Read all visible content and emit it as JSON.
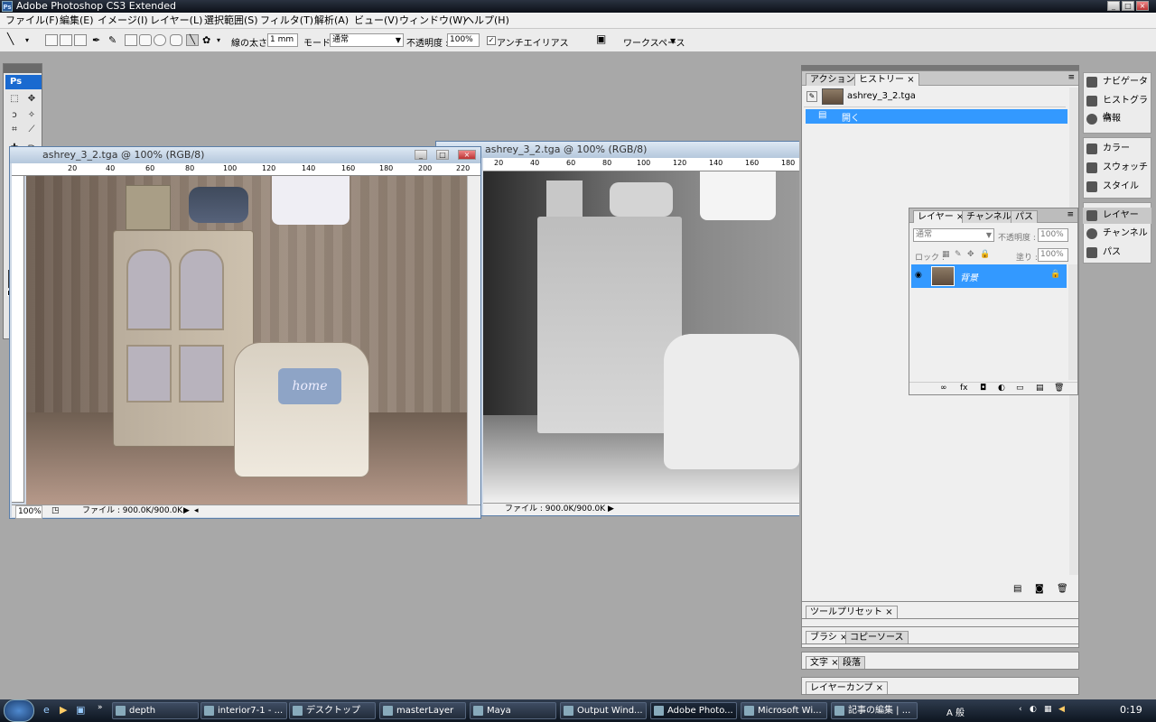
{
  "app": {
    "title": "Adobe Photoshop CS3 Extended"
  },
  "menu": [
    "ファイル(F)",
    "編集(E)",
    "イメージ(I)",
    "レイヤー(L)",
    "選択範囲(S)",
    "フィルタ(T)",
    "解析(A)",
    "ビュー(V)",
    "ウィンドウ(W)",
    "ヘルプ(H)"
  ],
  "options": {
    "stroke_label": "線の太さ :",
    "stroke_value": "1 mm",
    "mode_label": "モード :",
    "mode_value": "通常",
    "opacity_label": "不透明度 :",
    "opacity_value": "100%",
    "antialias_label": "アンチエイリアス",
    "workspace_label": "ワークスペース"
  },
  "toolbox": {
    "logo": "Ps"
  },
  "doc1": {
    "title": "ashrey_3_2.tga @ 100% (RGB/8)",
    "zoom": "100%",
    "file_info": "ファイル : 900.0K/900.0K",
    "ruler_ticks": [
      "20",
      "40",
      "60",
      "80",
      "100",
      "120",
      "140",
      "160",
      "180",
      "200",
      "220"
    ],
    "pillow_text": "home"
  },
  "doc2": {
    "title": "ashrey_3_2.tga @ 100% (RGB/8)",
    "file_info": "ファイル : 900.0K/900.0K",
    "ruler_ticks": [
      "20",
      "40",
      "60",
      "80",
      "100",
      "120",
      "140",
      "160",
      "180"
    ]
  },
  "history_panel": {
    "tabs": [
      "アクション",
      "ヒストリー"
    ],
    "snapshot": "ashrey_3_2.tga",
    "items": [
      "開く"
    ]
  },
  "layers_panel": {
    "tabs": [
      "レイヤー",
      "チャンネル",
      "パス"
    ],
    "blend_mode": "通常",
    "opacity_label": "不透明度 :",
    "opacity_value": "100%",
    "lock_label": "ロック :",
    "fill_label": "塗り :",
    "fill_value": "100%",
    "layers": [
      "背景"
    ]
  },
  "collapsed_panels": [
    "ツールプリセット",
    "ブラシ",
    "コピーソース",
    "文字",
    "段落",
    "レイヤーカンプ"
  ],
  "dock_icons": [
    "ナビゲータ",
    "ヒストグラム",
    "情報",
    "カラー",
    "スウォッチ",
    "スタイル",
    "レイヤー",
    "チャンネル",
    "パス"
  ],
  "taskbar": {
    "tasks": [
      "depth",
      "interior7-1 - ...",
      "デスクトップ",
      "masterLayer",
      "Maya",
      "Output Wind...",
      "Adobe Photo...",
      "Microsoft Wi...",
      "記事の編集 | ..."
    ],
    "ime": "A 般",
    "clock": "0:19"
  },
  "colors": {
    "foreground": "#ff0000",
    "background": "#7fa3c8",
    "accent": "#3399ff"
  }
}
